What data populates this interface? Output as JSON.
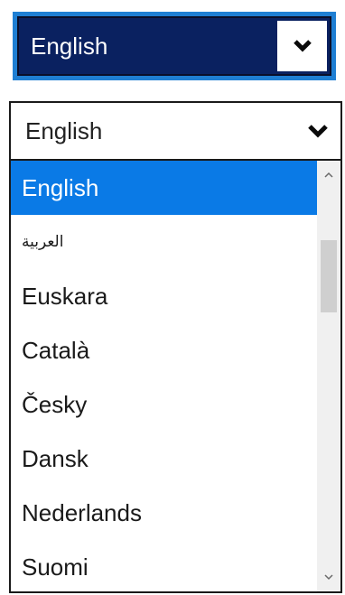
{
  "select_closed": {
    "value": "English",
    "arrow_icon": "chevron-down-icon"
  },
  "select_open": {
    "value": "English",
    "arrow_icon": "chevron-down-icon",
    "options": [
      {
        "label": "English",
        "selected": true
      },
      {
        "label": "العربية",
        "selected": false
      },
      {
        "label": "Euskara",
        "selected": false
      },
      {
        "label": "Català",
        "selected": false
      },
      {
        "label": "Česky",
        "selected": false
      },
      {
        "label": "Dansk",
        "selected": false
      },
      {
        "label": "Nederlands",
        "selected": false
      },
      {
        "label": "Suomi",
        "selected": false
      }
    ],
    "scrollbar": {
      "up_icon": "chevron-up-icon",
      "down_icon": "chevron-down-icon"
    }
  },
  "colors": {
    "closed_outer_border": "#1f7fd3",
    "closed_background": "#0a2160",
    "selected_option": "#0a7ae6",
    "scrollbar_track": "#f0f0f0",
    "scrollbar_thumb": "#cfcfcf"
  }
}
